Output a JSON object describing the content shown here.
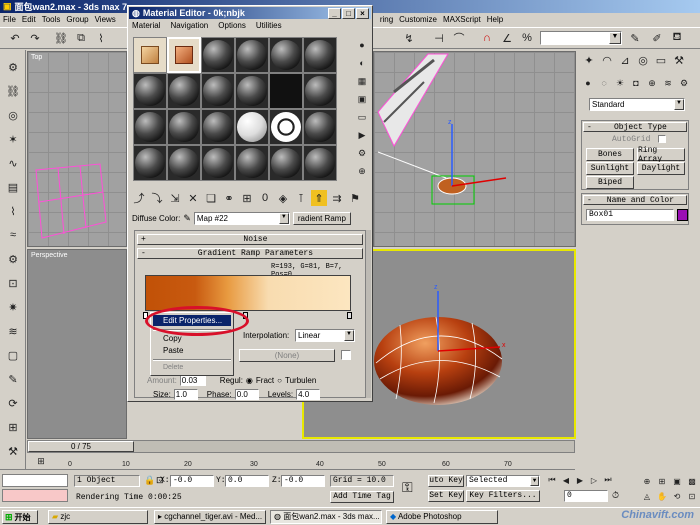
{
  "main_window": {
    "title": "面包wan2.max - 3ds max 7 -"
  },
  "menu": {
    "file": "File",
    "edit": "Edit",
    "tools": "Tools",
    "group": "Group",
    "views": "Views",
    "rendering": "ring",
    "customize": "Customize",
    "maxscript": "MAXScript",
    "help": "Help"
  },
  "viewports": {
    "top": "Top",
    "perspective": "Perspective"
  },
  "material_editor": {
    "title": "Material Editor - 0k;nbjk",
    "menu": {
      "material": "Material",
      "navigation": "Navigation",
      "options": "Options",
      "utilities": "Utilities"
    },
    "diffuse_label": "Diffuse Color:",
    "map_name": "Map #22",
    "map_type": "radient Ramp",
    "noise_rollout": "Noise",
    "gradient_rollout": "Gradient Ramp Parameters",
    "rgb_readout": "R=193, G=81, B=7,  Pos=0",
    "interpolation_label": "Interpolation:",
    "interpolation_value": "Linear",
    "none_label": "(None)",
    "context_menu": {
      "edit_properties": "Edit Properties...",
      "copy": "Copy",
      "paste": "Paste",
      "delete": "Delete"
    },
    "noise_params": {
      "amount_label": "Amount:",
      "amount_value": "0.03",
      "regular_label": "Regul:",
      "fractal_label": "Fract",
      "turbulence_label": "Turbulen",
      "size_label": "Size:",
      "size_value": "1.0",
      "phase_label": "Phase:",
      "phase_value": "0.0",
      "levels_label": "Levels:",
      "levels_value": "4.0"
    }
  },
  "command_panel": {
    "dropdown": "Standard",
    "object_type_rollout": "Object Type",
    "autogrid": "AutoGrid",
    "buttons": [
      "Bones",
      "Ring Array",
      "Sunlight",
      "Daylight",
      "Biped"
    ],
    "name_color_rollout": "Name and Color",
    "object_name": "Box01",
    "color_swatch": "#9a0eb4"
  },
  "timeline": {
    "slider": "0 / 75",
    "ticks": [
      "0",
      "10",
      "20",
      "30",
      "40",
      "50",
      "60",
      "70"
    ]
  },
  "status": {
    "selection": "1 Object",
    "x_label": "X:",
    "x_value": "-0.0",
    "y_label": "Y:",
    "y_value": "0.0",
    "z_label": "Z:",
    "z_value": "-0.0",
    "grid": "Grid = 10.0",
    "rendering_time": "Rendering Time  0:00:25",
    "add_time_tag": "Add Time Tag",
    "auto_key": "uto Key",
    "set_key": "Set Key",
    "selected": "Selected",
    "key_filters": "Key Filters...",
    "frame": "0"
  },
  "taskbar": {
    "start": "开始",
    "items": [
      "zjc",
      "cgchannel_tiger.avi - Med...",
      "面包wan2.max - 3ds max...",
      "Adobe Photoshop"
    ],
    "watermark": "Chinavift.com"
  },
  "colors": {
    "title_active": "#0a246a",
    "highlight_ring": "#d8102a",
    "viewport_bg": "#a1a1a1",
    "active_border": "#e8e800"
  }
}
